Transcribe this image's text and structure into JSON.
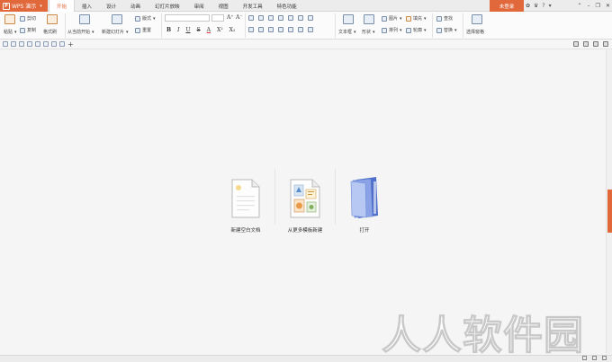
{
  "app": {
    "name": "WPS 演示",
    "logo_letter": "P"
  },
  "tabs": [
    {
      "label": "开始",
      "active": true
    },
    {
      "label": "插入"
    },
    {
      "label": "设计"
    },
    {
      "label": "动画"
    },
    {
      "label": "幻灯片放映"
    },
    {
      "label": "审阅"
    },
    {
      "label": "视图"
    },
    {
      "label": "开发工具"
    },
    {
      "label": "特色功能"
    }
  ],
  "header": {
    "login_label": "未登录"
  },
  "ribbon": {
    "paste": "粘贴",
    "cut": "剪切",
    "copy": "复制",
    "format_painter": "格式刷",
    "from_current": "从当前开始",
    "new_slide": "新建幻灯片",
    "layout": "版式",
    "reset": "重置",
    "bold": "B",
    "italic": "I",
    "underline": "U",
    "strike": "S",
    "font_color": "A",
    "superscript": "X²",
    "subscript": "X₂",
    "grow_font": "A⁺",
    "shrink_font": "A⁻",
    "textbox": "文本框",
    "shape": "形状",
    "picture": "图片",
    "fill": "填充",
    "arrange": "排列",
    "outline": "轮廓",
    "find": "查找",
    "replace": "替换",
    "select_pane": "选择窗格"
  },
  "start_page": {
    "items": [
      {
        "label": "新建空白文档"
      },
      {
        "label": "从更多模板新建"
      },
      {
        "label": "打开"
      }
    ]
  },
  "watermark": {
    "text": [
      "人",
      "人",
      "软",
      "件",
      "园"
    ]
  },
  "colors": {
    "accent": "#e0683a",
    "folder_blue": "#6b87d8"
  }
}
